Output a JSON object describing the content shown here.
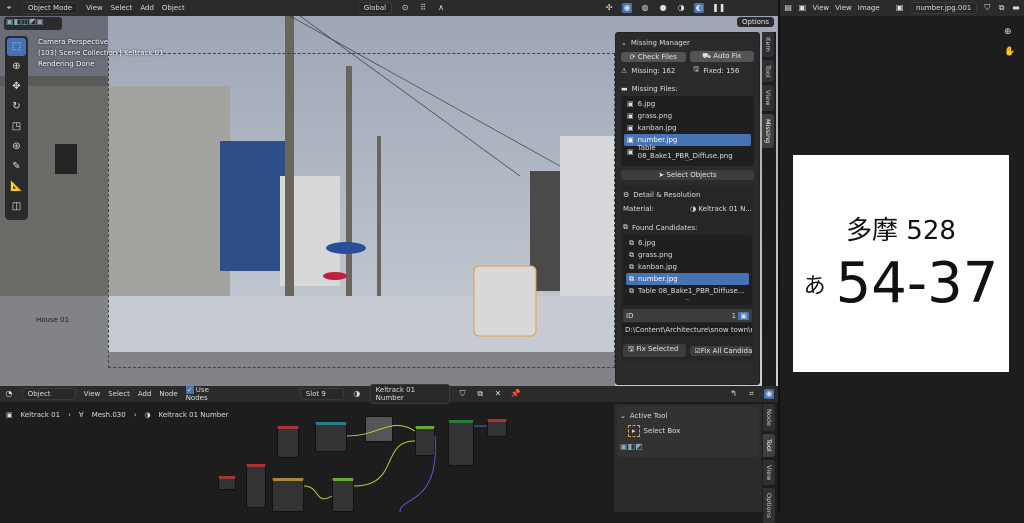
{
  "viewport": {
    "header": {
      "mode": "Object Mode",
      "menus": [
        "View",
        "Select",
        "Add",
        "Object"
      ],
      "orientation": "Global",
      "options": "Options"
    },
    "overlay": {
      "line1": "Camera Perspective",
      "line2": "(103) Scene Collection | Keltrack 01",
      "line3": "Rendering Done",
      "object_label": "House 01"
    },
    "tools": [
      "cursor-select",
      "cursor",
      "move",
      "rotate",
      "scale",
      "transform",
      "annotate",
      "measure",
      "add-cube"
    ]
  },
  "missing_manager": {
    "title": "Missing Manager",
    "check_files": "Check Files",
    "auto_fix": "Auto Fix",
    "missing": "Missing: 162",
    "fixed": "Fixed: 156",
    "missing_files_label": "Missing Files:",
    "missing_files": [
      "6.jpg",
      "grass.png",
      "kanban.jpg",
      "number.jpg",
      "Table 08_Bake1_PBR_Diffuse.png"
    ],
    "selected_index": 3,
    "select_objects": "Select Objects",
    "detail_title": "Detail & Resolution",
    "material_label": "Material:",
    "material_value": "Keltrack 01 N...",
    "found_label": "Found Candidates:",
    "candidates": [
      "6.jpg",
      "grass.png",
      "kanban.jpg",
      "number.jpg",
      "Table 08_Bake1_PBR_Diffuse..."
    ],
    "id_label": "ID",
    "id_value": "1",
    "path": "D:\\Content\\Architecture\\snow town\\nu...",
    "fix_selected": "Fix Selected",
    "fix_all": "Fix All Candidat..."
  },
  "viewport_tabs": [
    "Item",
    "Tool",
    "View",
    "Missing"
  ],
  "node_editor": {
    "header": {
      "type": "Object",
      "menus": [
        "View",
        "Select",
        "Add",
        "Node"
      ],
      "use_nodes": "Use Nodes",
      "slot": "Slot 9",
      "material": "Keltrack 01 Number"
    },
    "breadcrumb": [
      "Keltrack 01",
      "Mesh.030",
      "Keltrack 01 Number"
    ],
    "active_tool_title": "Active Tool",
    "active_tool": "Select Box",
    "tabs": [
      "Node",
      "Tool",
      "View",
      "Options"
    ]
  },
  "image_editor": {
    "menus": [
      "View",
      "View",
      "Image"
    ],
    "image_name": "number.jpg.001",
    "plate_top": "多摩 528",
    "plate_kana": "あ",
    "plate_number": "54-37"
  }
}
